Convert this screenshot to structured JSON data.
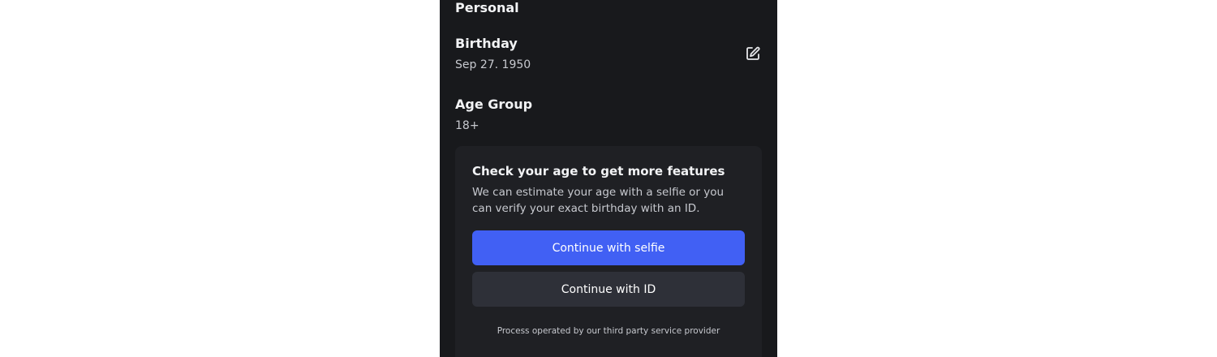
{
  "personal": {
    "section_title": "Personal",
    "birthday": {
      "label": "Birthday",
      "value": "Sep 27. 1950",
      "edit_icon": "edit-icon"
    },
    "age_group": {
      "label": "Age Group",
      "value": "18+"
    }
  },
  "age_check": {
    "title": "Check your age to get more features",
    "description": "We can estimate your age with a selfie or you can verify your exact birthday with an ID.",
    "selfie_button": "Continue with selfie",
    "id_button": "Continue with ID",
    "footer": "Process operated by our third party service provider"
  },
  "colors": {
    "background": "#18191c",
    "card": "#1f2024",
    "primary_button": "#4160f4",
    "secondary_button": "#2e3038"
  }
}
